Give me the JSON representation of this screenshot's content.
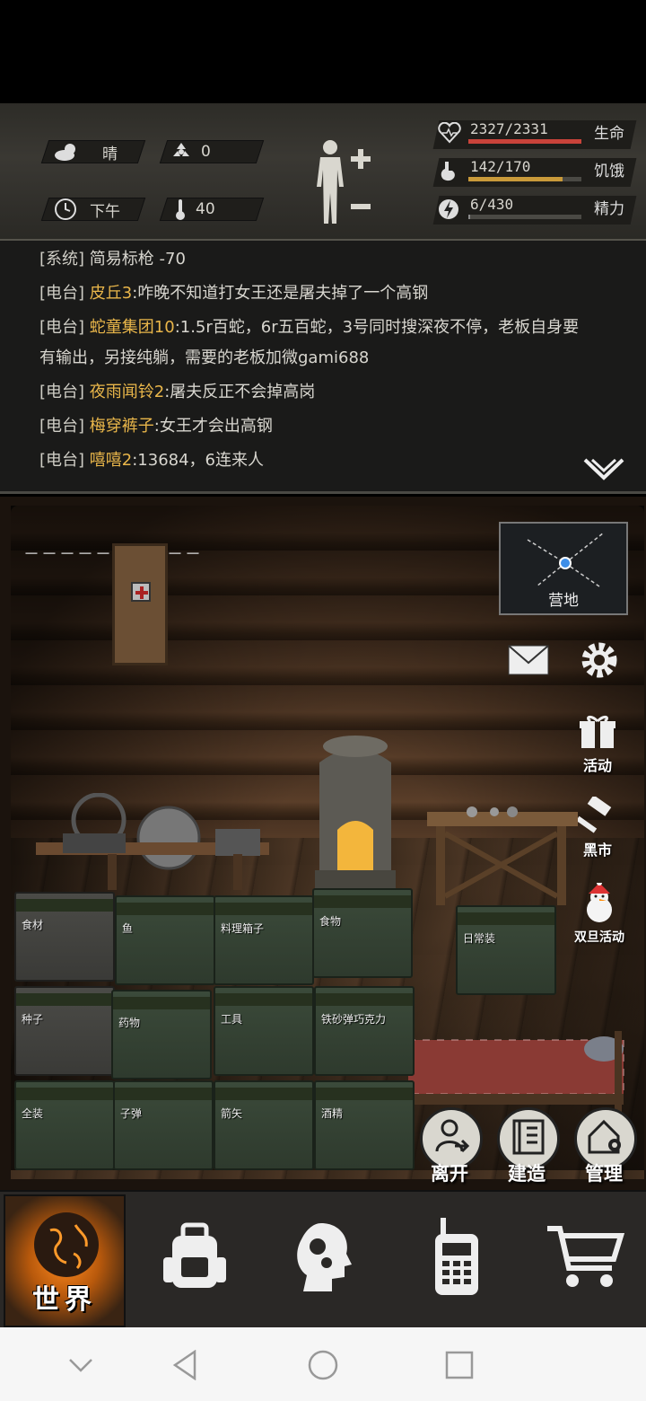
{
  "status": {
    "weather": "晴",
    "radiation": "0",
    "time_of_day": "下午",
    "temperature": "40",
    "stats": [
      {
        "name": "生命",
        "value": "2327/2331",
        "fill": 0.998,
        "color": "#c9433a"
      },
      {
        "name": "饥饿",
        "value": "142/170",
        "fill": 0.835,
        "color": "#c99a3a"
      },
      {
        "name": "精力",
        "value": "6/430",
        "fill": 0.014,
        "color": "#8a8a8a"
      }
    ]
  },
  "log": {
    "lines": [
      {
        "tag": "[系统]",
        "name": "",
        "text": "简易标枪 -70"
      },
      {
        "tag": "[电台]",
        "name": "皮丘3",
        "text": ":咋晚不知道打女王还是屠夫掉了一个高钢"
      },
      {
        "tag": "[电台]",
        "name": "蛇童集团10",
        "text": ":1.5r百蛇，6r五百蛇，3号同时搜深夜不停，老板自身要"
      },
      {
        "tag": "",
        "name": "",
        "text": "有输出，另接纯躺，需要的老板加微gami688"
      },
      {
        "tag": "[电台]",
        "name": "夜雨闻铃2",
        "text": ":屠夫反正不会掉高岗"
      },
      {
        "tag": "[电台]",
        "name": "梅穿裤子",
        "text": ":女王才会出高钢"
      },
      {
        "tag": "[电台]",
        "name": "嘻嘻2",
        "text": ":13684，6连来人"
      }
    ]
  },
  "scene": {
    "dashes": "－－－－－－－－－－",
    "minimap_label": "营地",
    "crates": [
      "食材",
      "鱼",
      "料理箱子",
      "食物",
      "日常装",
      "种子",
      "药物",
      "工具",
      "铁砂弹巧克力",
      "全装",
      "子弹",
      "箭矢",
      "酒精"
    ],
    "side_buttons": {
      "activity": "活动",
      "black_market": "黑市",
      "holiday": "双旦活动"
    },
    "actions": {
      "leave": "离开",
      "build": "建造",
      "manage": "管理"
    }
  },
  "nav": {
    "world": "世界"
  },
  "colors": {
    "accent_orange": "#e9b64a",
    "health_red": "#c9433a"
  }
}
